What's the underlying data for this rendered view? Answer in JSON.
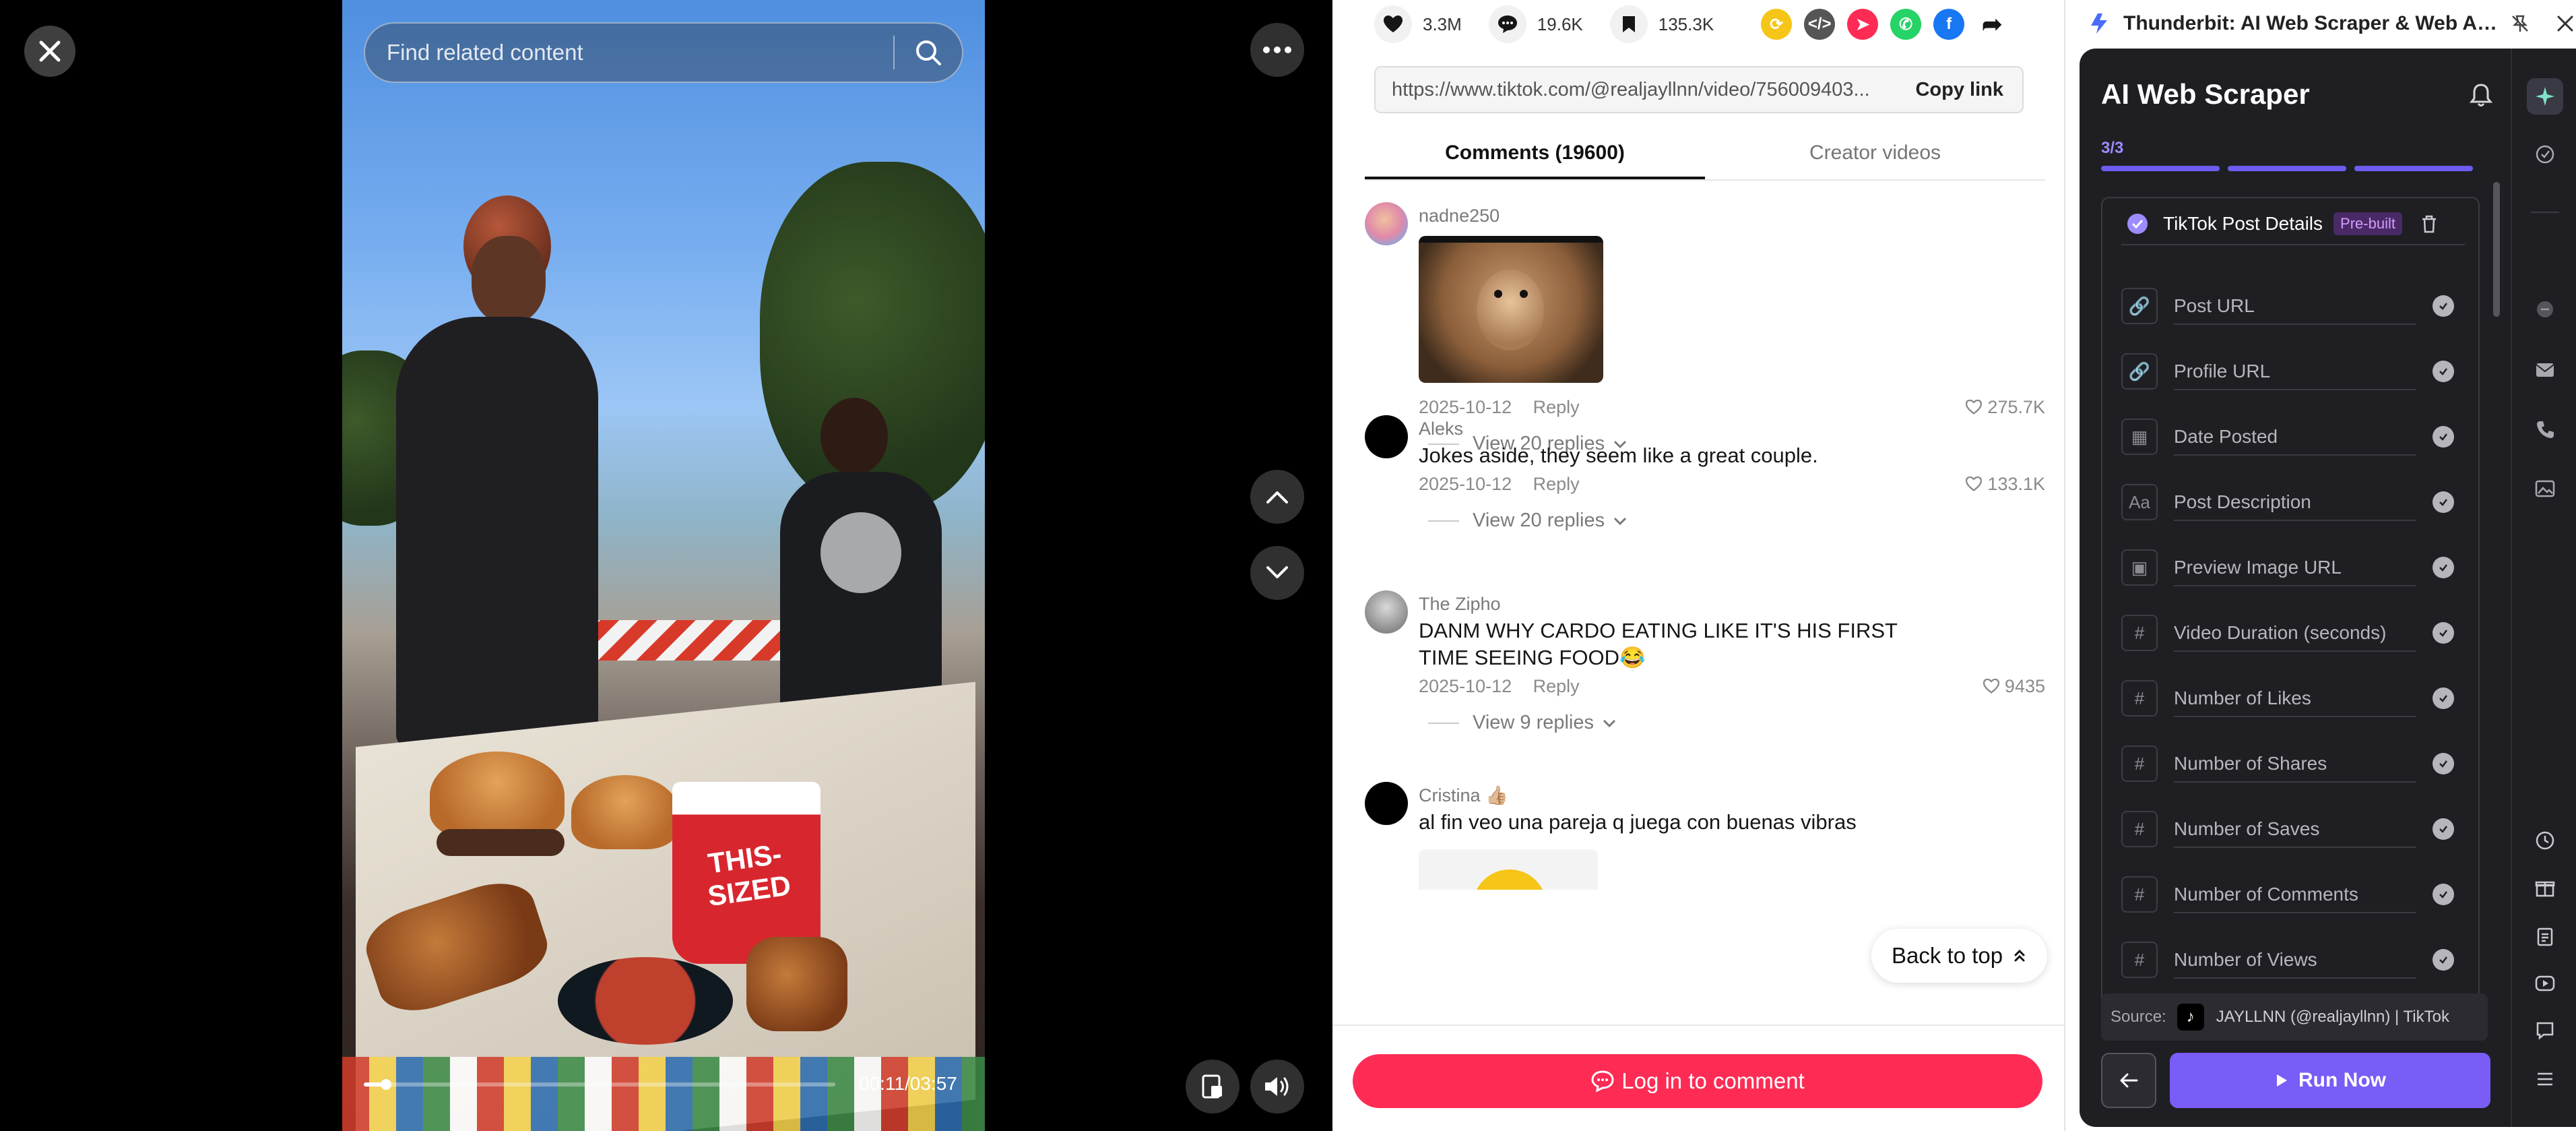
{
  "video": {
    "search_placeholder": "Find related content",
    "time": "00:11/03:57",
    "progress_fraction": 0.047,
    "cup_text": "THIS-SIZED"
  },
  "stats": {
    "likes": "3.3M",
    "comments": "19.6K",
    "saves": "135.3K"
  },
  "url": {
    "value": "https://www.tiktok.com/@realjayllnn/video/756009403...",
    "copy_label": "Copy link"
  },
  "tabs": [
    {
      "label": "Comments (19600)"
    },
    {
      "label": "Creator videos"
    }
  ],
  "comments": [
    {
      "user": "nadne250",
      "text": "",
      "date": "2025-10-12",
      "reply": "Reply",
      "likes": "275.7K",
      "view_replies": "View 20 replies"
    },
    {
      "user": "Aleks",
      "text": "Jokes aside, they seem like a great couple.",
      "date": "2025-10-12",
      "reply": "Reply",
      "likes": "133.1K",
      "view_replies": "View 20 replies"
    },
    {
      "user": "The Zipho",
      "text": "DANM WHY CARDO EATING LIKE IT'S HIS FIRST TIME SEEING FOOD😂",
      "date": "2025-10-12",
      "reply": "Reply",
      "likes": "9435",
      "view_replies": "View 9 replies"
    },
    {
      "user": "Cristina 👍🏼",
      "text": "al fin veo una pareja q juega con buenas vibras",
      "date": "",
      "reply": "",
      "likes": "",
      "view_replies": ""
    }
  ],
  "back_to_top": "Back to top",
  "login_label": "Log in to comment",
  "extension": {
    "title": "Thunderbit: AI Web Scraper & Web Au...",
    "heading": "AI Web Scraper",
    "step": "3/3",
    "template_name": "TikTok Post Details",
    "template_badge": "Pre-built",
    "fields": [
      {
        "name": "Post URL",
        "icon": "link-icon"
      },
      {
        "name": "Profile URL",
        "icon": "link-icon"
      },
      {
        "name": "Date Posted",
        "icon": "calendar-icon"
      },
      {
        "name": "Post Description",
        "icon": "text-icon"
      },
      {
        "name": "Preview Image URL",
        "icon": "image-icon"
      },
      {
        "name": "Video Duration (seconds)",
        "icon": "hash-icon"
      },
      {
        "name": "Number of Likes",
        "icon": "hash-icon"
      },
      {
        "name": "Number of Shares",
        "icon": "hash-icon"
      },
      {
        "name": "Number of Saves",
        "icon": "hash-icon"
      },
      {
        "name": "Number of Comments",
        "icon": "hash-icon"
      },
      {
        "name": "Number of Views",
        "icon": "hash-icon"
      }
    ],
    "source_label": "Source:",
    "source_value": "JAYLLNN (@realjayllnn) | TikTok",
    "run_label": "Run Now"
  },
  "colors": {
    "tiktok_red": "#fe2c55",
    "thunderbit_purple": "#7a5cf7",
    "badge_purple": "#d59cff"
  }
}
